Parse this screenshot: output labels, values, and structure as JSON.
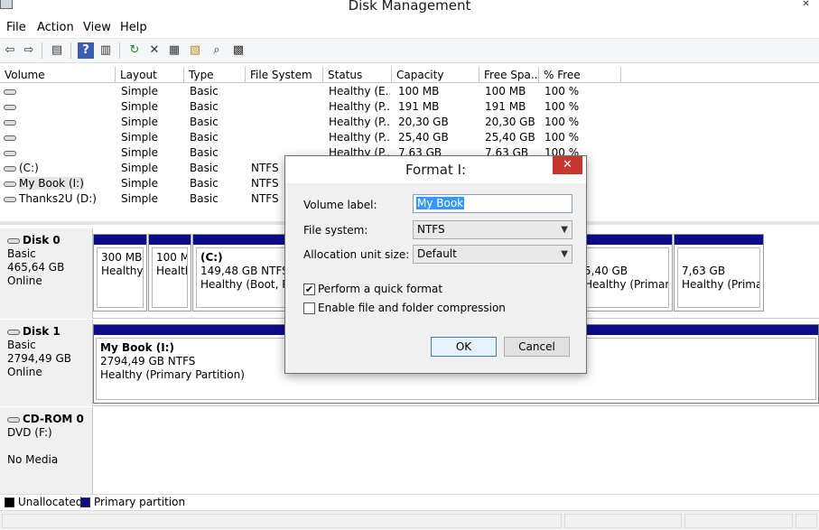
{
  "window": {
    "title": "Disk Management"
  },
  "menu": [
    "File",
    "Action",
    "View",
    "Help"
  ],
  "toolbar": {
    "icons": [
      "back-arrow-icon",
      "forward-arrow-icon",
      "console-tree-icon",
      "help-icon",
      "action-pane-icon",
      "refresh-icon",
      "delete-icon",
      "properties-icon",
      "open-folder-icon",
      "search-icon",
      "settings-icon"
    ],
    "glyphs": [
      "⇦",
      "⇨",
      "▤",
      "?",
      "▥",
      "↻",
      "✕",
      "▦",
      "▧",
      "⌕",
      "▩"
    ]
  },
  "volume_table": {
    "columns": [
      "Volume",
      "Layout",
      "Type",
      "File System",
      "Status",
      "Capacity",
      "Free Spa...",
      "% Free"
    ],
    "rows": [
      {
        "volume": "",
        "layout": "Simple",
        "type": "Basic",
        "fs": "",
        "status": "Healthy (E...",
        "capacity": "100 MB",
        "free": "100 MB",
        "pct": "100 %"
      },
      {
        "volume": "",
        "layout": "Simple",
        "type": "Basic",
        "fs": "",
        "status": "Healthy (P...",
        "capacity": "191 MB",
        "free": "191 MB",
        "pct": "100 %"
      },
      {
        "volume": "",
        "layout": "Simple",
        "type": "Basic",
        "fs": "",
        "status": "Healthy (P...",
        "capacity": "20,30 GB",
        "free": "20,30 GB",
        "pct": "100 %"
      },
      {
        "volume": "",
        "layout": "Simple",
        "type": "Basic",
        "fs": "",
        "status": "Healthy (P...",
        "capacity": "25,40 GB",
        "free": "25,40 GB",
        "pct": "100 %"
      },
      {
        "volume": "",
        "layout": "Simple",
        "type": "Basic",
        "fs": "",
        "status": "Healthy (P...",
        "capacity": "7,63 GB",
        "free": "7,63 GB",
        "pct": "100 %"
      },
      {
        "volume": "(C:)",
        "layout": "Simple",
        "type": "Basic",
        "fs": "NTFS",
        "status": "",
        "capacity": "",
        "free": "",
        "pct": ""
      },
      {
        "volume": "My Book (I:)",
        "layout": "Simple",
        "type": "Basic",
        "fs": "NTFS",
        "status": "",
        "capacity": "",
        "free": "",
        "pct": ""
      },
      {
        "volume": "Thanks2U (D:)",
        "layout": "Simple",
        "type": "Basic",
        "fs": "NTFS",
        "status": "",
        "capacity": "",
        "free": "",
        "pct": ""
      }
    ]
  },
  "disks": [
    {
      "name": "Disk 0",
      "kind": "Basic",
      "size": "465,64 GB",
      "state": "Online",
      "partitions": [
        {
          "title": "",
          "size": "300 MB",
          "status": "Healthy"
        },
        {
          "title": "",
          "size": "100 M",
          "status": "Health"
        },
        {
          "title": "(C:)",
          "size": "149,48 GB NTFS",
          "status": "Healthy (Boot, Pag"
        },
        {
          "title": "",
          "size": "5,40 GB",
          "status": "Healthy (Primary"
        },
        {
          "title": "",
          "size": "7,63 GB",
          "status": "Healthy (Primar"
        }
      ]
    },
    {
      "name": "Disk 1",
      "kind": "Basic",
      "size": "2794,49 GB",
      "state": "Online",
      "partitions": [
        {
          "title": "My Book  (I:)",
          "size": "2794,49 GB NTFS",
          "status": "Healthy (Primary Partition)"
        }
      ]
    },
    {
      "name": "CD-ROM 0",
      "kind": "DVD (F:)",
      "size": "",
      "state": "No Media",
      "partitions": []
    }
  ],
  "legend": [
    {
      "label": "Unallocated",
      "color": "#000000"
    },
    {
      "label": "Primary partition",
      "color": "#0c0c8a"
    }
  ],
  "dialog": {
    "title": "Format I:",
    "close_glyph": "✕",
    "volume_label_label": "Volume label:",
    "volume_label_value": "My Book",
    "file_system_label": "File system:",
    "file_system_value": "NTFS",
    "alloc_label": "Allocation unit size:",
    "alloc_value": "Default",
    "quick_format_label": "Perform a quick format",
    "quick_format_checked": true,
    "compression_label": "Enable file and folder compression",
    "compression_checked": false,
    "ok_label": "OK",
    "cancel_label": "Cancel"
  }
}
